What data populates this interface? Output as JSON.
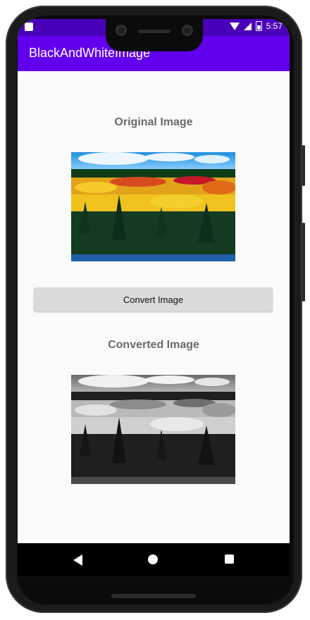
{
  "status_bar": {
    "time": "5:57"
  },
  "app_bar": {
    "title": "BlackAndWhiteImage"
  },
  "main": {
    "original_label": "Original Image",
    "convert_button_label": "Convert Image",
    "converted_label": "Converted Image"
  },
  "colors": {
    "status_bar": "#4a00b8",
    "app_bar": "#6200ee",
    "background": "#fafafa"
  },
  "icons": {
    "status_left": "sim-icon",
    "wifi": "wifi-icon",
    "signal": "signal-icon",
    "battery": "battery-icon",
    "nav_back": "back-icon",
    "nav_home": "home-icon",
    "nav_recents": "recents-icon"
  }
}
